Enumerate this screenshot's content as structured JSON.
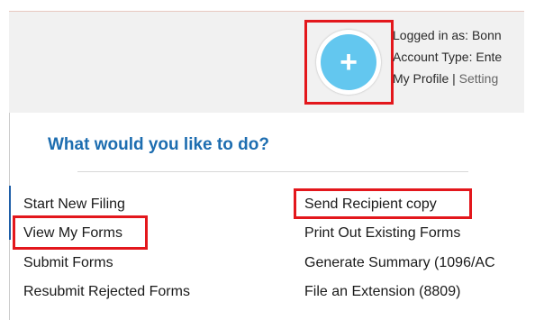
{
  "header": {
    "add_icon": "plus-icon",
    "add_glyph": "+",
    "logged_in": "Logged in as: Bonn",
    "account_type": "Account Type: Ente",
    "profile_link": "My Profile",
    "separator": "|",
    "settings_link": "Setting"
  },
  "panel": {
    "title": "What would you like to do?",
    "left_column": [
      "Start New Filing",
      "View My Forms",
      "Submit Forms",
      "Resubmit Rejected Forms"
    ],
    "right_column": [
      "Send Recipient copy",
      "Print Out Existing Forms",
      "Generate Summary (1096/AC",
      "File an Extension (8809)"
    ]
  },
  "colors": {
    "accent_blue": "#1d6db0",
    "add_button": "#63c7ef",
    "highlight_red": "#e3171c",
    "header_bg": "#f1f1f1"
  }
}
